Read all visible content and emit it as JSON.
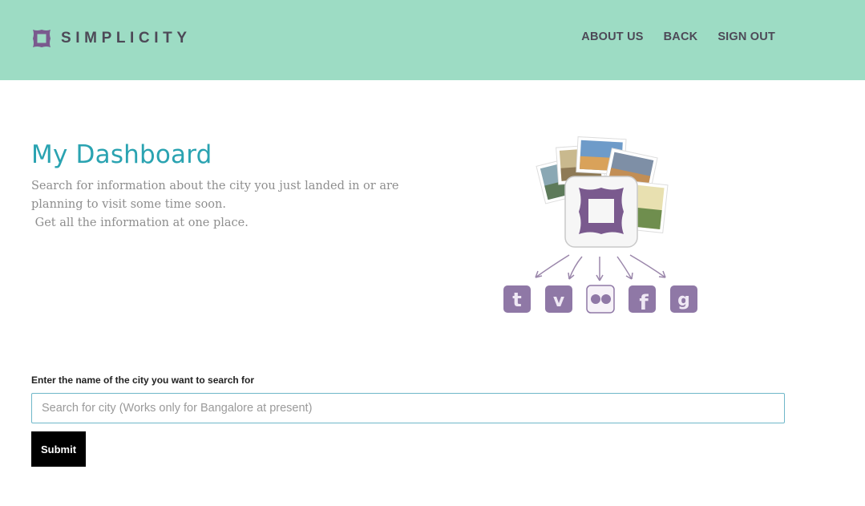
{
  "header": {
    "brand": "SIMPLICITY",
    "brand_logo_icon": "frame-logo-icon",
    "nav": [
      {
        "label": "ABOUT US"
      },
      {
        "label": "BACK"
      },
      {
        "label": "SIGN OUT"
      }
    ]
  },
  "main": {
    "title": "My Dashboard",
    "intro_lines": [
      "Search for information about the city you just landed in or are",
      "planning to visit some time soon.",
      " Get all the information at one place."
    ],
    "illustration_icons": [
      "photo-stack-icon",
      "frame-app-icon",
      "tumblr-icon",
      "vimeo-icon",
      "flickr-icon",
      "facebook-icon",
      "google-icon"
    ]
  },
  "search": {
    "label": "Enter the name of the city you want to search for",
    "placeholder": "Search for city (Works only for Bangalore at present)",
    "value": "",
    "submit_label": "Submit"
  },
  "colors": {
    "header_bg": "#9ddcc4",
    "brand_purple": "#7a5a8e",
    "title_teal": "#2aa3b1",
    "nav_text": "#4d4957",
    "button_bg": "#000000"
  }
}
